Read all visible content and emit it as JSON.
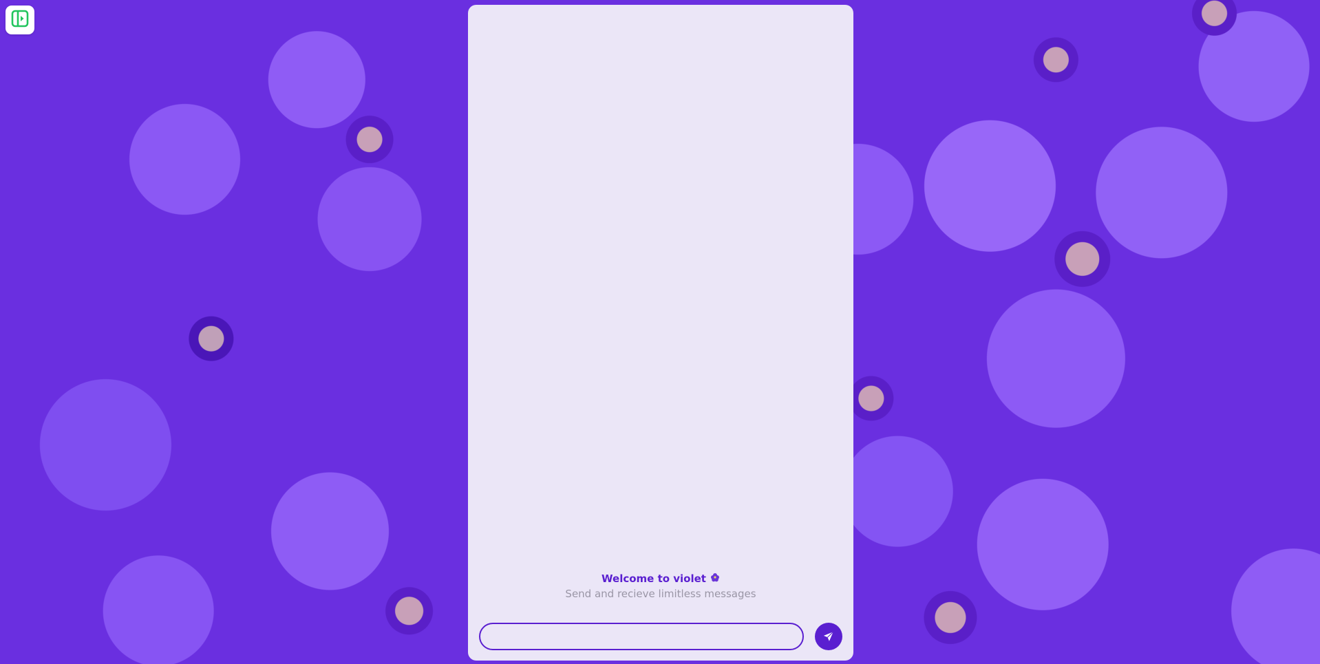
{
  "app": {
    "logo_icon": "sidebar-toggle-icon",
    "logo_color": "#22c55e"
  },
  "welcome": {
    "title": "Welcome to violet",
    "title_icon": "violet-flower-icon",
    "subtitle": "Send and recieve limitless messages"
  },
  "composer": {
    "input_value": "",
    "input_placeholder": "",
    "send_icon": "send-icon"
  },
  "colors": {
    "accent": "#5a1fd0",
    "panel": "#ebe6f7",
    "muted_text": "#9a96a6"
  }
}
